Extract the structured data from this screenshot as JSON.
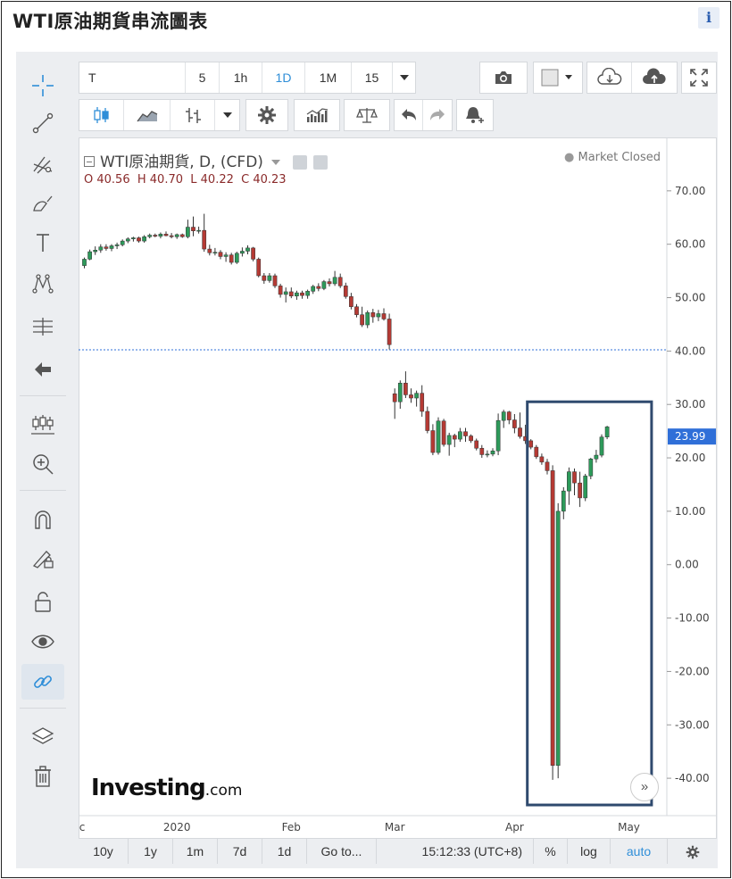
{
  "page": {
    "title": "WTI原油期貨串流圖表",
    "info_label": "i"
  },
  "toolbar": {
    "symbol": "T",
    "intervals": [
      "5",
      "1h",
      "1D",
      "1M",
      "15"
    ],
    "selected_interval": "1D"
  },
  "legend": {
    "symbol_title": "WTI原油期貨, D, (CFD)",
    "open_label": "O",
    "open": "40.56",
    "high_label": "H",
    "high": "40.70",
    "low_label": "L",
    "low": "40.22",
    "close_label": "C",
    "close": "40.23",
    "status": "Market Closed"
  },
  "logo": {
    "main": "Investing",
    "suffix": ".com"
  },
  "bottom_bar": {
    "ranges": [
      "10y",
      "1y",
      "1m",
      "7d",
      "1d",
      "Go to..."
    ],
    "time": "15:12:33 (UTC+8)",
    "percent": "%",
    "log": "log",
    "auto": "auto"
  },
  "colors": {
    "up": "#2d9a5a",
    "down": "#b53a34",
    "price_tag": "#2f6fd8",
    "highlight_box": "#2f4a6e",
    "last_close_line": "#2f6fd8"
  },
  "chart_data": {
    "type": "candlestick",
    "y_ticks": [
      "70.00",
      "60.00",
      "50.00",
      "40.00",
      "30.00",
      "20.00",
      "10.00",
      "0.00",
      "-10.00",
      "-20.00",
      "-30.00",
      "-40.00"
    ],
    "ylim": [
      -47,
      80
    ],
    "x_labels": [
      {
        "label": "ec",
        "index": -1
      },
      {
        "label": "2020",
        "index": 17
      },
      {
        "label": "Feb",
        "index": 38
      },
      {
        "label": "Mar",
        "index": 57
      },
      {
        "label": "Apr",
        "index": 79
      },
      {
        "label": "May",
        "index": 100
      }
    ],
    "last_price_tag": "23.99",
    "last_close_line_value": 40.23,
    "highlight_range": {
      "from_index": 82,
      "to_index": 104,
      "y_from": 30.5,
      "y_to": -45
    },
    "candles": [
      [
        56.0,
        57.5,
        55.5,
        57.2
      ],
      [
        57.2,
        59.0,
        57.0,
        58.6
      ],
      [
        58.6,
        59.6,
        58.0,
        58.9
      ],
      [
        58.9,
        60.0,
        58.4,
        59.5
      ],
      [
        59.5,
        60.0,
        58.8,
        59.2
      ],
      [
        59.2,
        60.0,
        58.7,
        59.7
      ],
      [
        59.7,
        60.3,
        59.1,
        59.9
      ],
      [
        59.9,
        60.9,
        59.6,
        60.6
      ],
      [
        60.6,
        61.3,
        60.2,
        61.0
      ],
      [
        61.0,
        61.4,
        60.5,
        61.2
      ],
      [
        61.2,
        61.4,
        60.3,
        60.6
      ],
      [
        60.6,
        61.7,
        60.3,
        61.4
      ],
      [
        61.4,
        62.0,
        61.1,
        61.7
      ],
      [
        61.7,
        62.0,
        61.3,
        61.5
      ],
      [
        61.5,
        62.2,
        61.1,
        61.9
      ],
      [
        61.9,
        62.4,
        61.5,
        61.6
      ],
      [
        61.6,
        62.1,
        61.1,
        61.4
      ],
      [
        61.4,
        62.0,
        61.0,
        61.8
      ],
      [
        61.8,
        62.0,
        61.2,
        61.4
      ],
      [
        61.4,
        64.6,
        61.1,
        63.2
      ],
      [
        63.2,
        65.2,
        61.5,
        62.5
      ],
      [
        62.5,
        63.3,
        62.0,
        62.6
      ],
      [
        62.6,
        65.7,
        58.6,
        59.1
      ],
      [
        59.1,
        59.9,
        57.9,
        58.4
      ],
      [
        58.4,
        59.3,
        57.9,
        58.5
      ],
      [
        58.5,
        58.9,
        57.2,
        57.7
      ],
      [
        57.7,
        58.5,
        56.7,
        58.0
      ],
      [
        58.0,
        58.4,
        56.2,
        56.6
      ],
      [
        56.6,
        58.6,
        56.3,
        58.3
      ],
      [
        58.3,
        59.4,
        57.7,
        58.7
      ],
      [
        58.7,
        59.8,
        58.1,
        59.3
      ],
      [
        59.3,
        59.5,
        56.8,
        57.2
      ],
      [
        57.2,
        57.5,
        53.8,
        54.1
      ],
      [
        54.1,
        54.6,
        52.6,
        53.2
      ],
      [
        53.2,
        54.6,
        52.8,
        54.1
      ],
      [
        54.1,
        54.5,
        51.8,
        52.2
      ],
      [
        52.2,
        52.6,
        50.0,
        50.6
      ],
      [
        50.6,
        51.9,
        49.1,
        51.1
      ],
      [
        51.1,
        51.9,
        49.9,
        50.3
      ],
      [
        50.3,
        51.3,
        49.6,
        50.9
      ],
      [
        50.9,
        51.3,
        49.8,
        50.4
      ],
      [
        50.4,
        51.5,
        49.8,
        51.2
      ],
      [
        51.2,
        52.4,
        50.7,
        52.1
      ],
      [
        52.1,
        52.7,
        51.2,
        51.7
      ],
      [
        51.7,
        53.3,
        51.4,
        53.0
      ],
      [
        53.0,
        53.6,
        52.1,
        52.6
      ],
      [
        52.6,
        55.0,
        52.2,
        53.8
      ],
      [
        53.8,
        54.5,
        51.8,
        52.2
      ],
      [
        52.2,
        52.8,
        49.8,
        50.2
      ],
      [
        50.2,
        50.9,
        47.8,
        48.3
      ],
      [
        48.3,
        48.8,
        46.3,
        46.8
      ],
      [
        46.8,
        48.3,
        44.5,
        44.9
      ],
      [
        44.9,
        47.6,
        44.3,
        47.2
      ],
      [
        47.2,
        47.9,
        45.3,
        46.4
      ],
      [
        46.4,
        47.7,
        45.6,
        47.0
      ],
      [
        47.0,
        48.0,
        45.7,
        46.0
      ],
      [
        46.0,
        47.0,
        40.3,
        41.2
      ],
      [
        32.0,
        33.0,
        27.3,
        30.5
      ],
      [
        30.5,
        34.5,
        29.2,
        34.0
      ],
      [
        34.0,
        36.2,
        31.2,
        31.8
      ],
      [
        31.8,
        33.0,
        30.3,
        31.2
      ],
      [
        31.2,
        32.6,
        29.6,
        32.1
      ],
      [
        32.1,
        33.6,
        27.7,
        28.7
      ],
      [
        28.7,
        29.6,
        24.6,
        25.1
      ],
      [
        25.1,
        26.3,
        20.5,
        21.0
      ],
      [
        21.0,
        27.6,
        20.6,
        26.9
      ],
      [
        26.9,
        27.3,
        22.1,
        22.5
      ],
      [
        22.5,
        24.7,
        20.4,
        24.2
      ],
      [
        24.2,
        24.5,
        22.0,
        23.5
      ],
      [
        23.5,
        25.6,
        23.0,
        24.9
      ],
      [
        24.9,
        25.6,
        23.0,
        24.1
      ],
      [
        24.1,
        24.4,
        22.8,
        23.2
      ],
      [
        23.2,
        23.6,
        21.4,
        21.8
      ],
      [
        21.8,
        22.4,
        20.0,
        20.6
      ],
      [
        20.6,
        21.4,
        20.1,
        20.7
      ],
      [
        20.7,
        21.8,
        20.3,
        21.3
      ],
      [
        21.3,
        28.3,
        20.5,
        27.0
      ],
      [
        27.0,
        29.0,
        25.6,
        28.6
      ],
      [
        28.6,
        28.8,
        26.3,
        27.1
      ],
      [
        27.1,
        28.2,
        24.6,
        25.6
      ],
      [
        25.6,
        28.5,
        23.6,
        24.0
      ],
      [
        24.0,
        26.2,
        22.6,
        23.2
      ],
      [
        23.2,
        23.5,
        21.6,
        22.0
      ],
      [
        22.0,
        22.4,
        19.8,
        20.2
      ],
      [
        20.2,
        20.8,
        18.7,
        19.2
      ],
      [
        19.2,
        19.8,
        16.9,
        17.6
      ],
      [
        17.6,
        18.6,
        -40.3,
        -37.6
      ],
      [
        -37.6,
        11.5,
        -40.0,
        10.0
      ],
      [
        10.0,
        14.5,
        8.5,
        13.8
      ],
      [
        13.8,
        18.2,
        11.2,
        17.4
      ],
      [
        17.4,
        18.0,
        13.0,
        15.3
      ],
      [
        15.3,
        17.4,
        10.8,
        12.5
      ],
      [
        12.5,
        17.0,
        11.9,
        16.6
      ],
      [
        16.6,
        20.0,
        16.0,
        19.8
      ],
      [
        19.8,
        21.5,
        19.1,
        20.5
      ],
      [
        20.5,
        24.4,
        20.1,
        23.9
      ],
      [
        23.9,
        26.0,
        23.5,
        25.8
      ]
    ]
  }
}
